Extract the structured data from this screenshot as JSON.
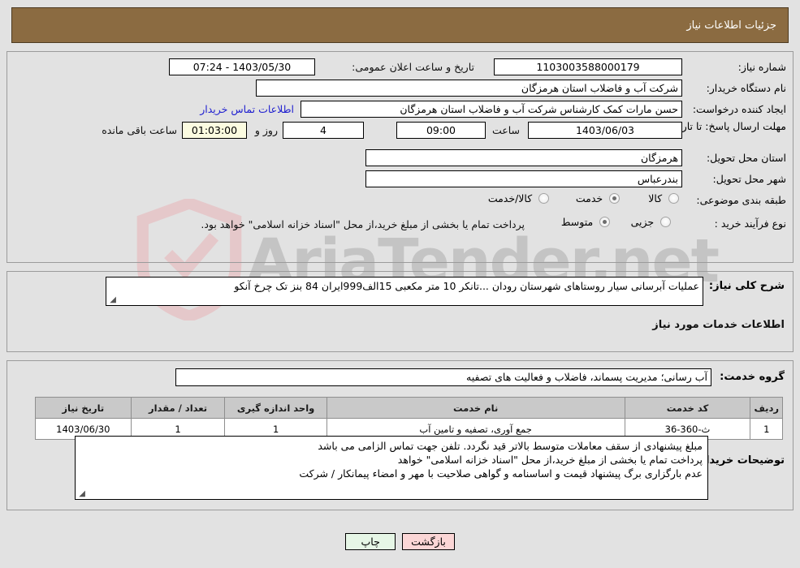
{
  "page": {
    "header_title": "جزئیات اطلاعات نیاز",
    "watermark_text": "AriaTender.net"
  },
  "colors": {
    "header_bg": "#8b6b41",
    "header_text": "#ffffff",
    "page_bg": "#e2e2e2",
    "link": "#2020d0",
    "table_header_bg": "#c9c9c9",
    "highlight_field_bg": "#fbfbe0",
    "print_button_bg": "#e6f6e6",
    "back_button_bg": "#fbd6d6"
  },
  "info": {
    "need_number_label": "شماره نیاز:",
    "need_number_value": "1103003588000179",
    "announce_datetime_label": "تاریخ و ساعت اعلان عمومی:",
    "announce_datetime_value": "1403/05/30 - 07:24",
    "buyer_org_label": "نام دستگاه خریدار:",
    "buyer_org_value": "شرکت آب و فاضلاب استان هرمزگان",
    "creator_label": "ایجاد کننده درخواست:",
    "creator_value": "حسن مارات کمک کارشناس شرکت آب و فاضلاب استان هرمزگان",
    "contact_link": "اطلاعات تماس خریدار",
    "deadline_label": "مهلت ارسال پاسخ: تا تاریخ:",
    "deadline_date": "1403/06/03",
    "hour_label": "ساعت",
    "hour_value": "09:00",
    "days_value": "4",
    "days_and_label": "روز و",
    "remaining_value": "01:03:00",
    "remaining_label": "ساعت باقی مانده",
    "province_label": "استان محل تحویل:",
    "province_value": "هرمزگان",
    "city_label": "شهر محل تحویل:",
    "city_value": "بندرعباس",
    "category_label": "طبقه بندی موضوعی:",
    "category_options": [
      "کالا",
      "خدمت",
      "کالا/خدمت"
    ],
    "category_selected": "خدمت",
    "process_label": "نوع فرآیند خرید :",
    "process_options": [
      "جزیی",
      "متوسط"
    ],
    "process_selected": "متوسط",
    "treasury_note": "پرداخت تمام یا بخشی از مبلغ خرید،از محل \"اسناد خزانه اسلامی\" خواهد بود."
  },
  "description": {
    "label": "شرح کلی نیاز:",
    "value": "عملیات آبرسانی سیار روستاهای شهرستان رودان ...تانکر 10 متر مکعبی 15الف999ایران 84  بنز تک چرخ آنکو"
  },
  "services": {
    "section_title": "اطلاعات خدمات مورد نیاز",
    "group_label": "گروه خدمت:",
    "group_value": "آب رسانی؛ مدیریت پسماند، فاضلاب و فعالیت های تصفیه",
    "columns": [
      "ردیف",
      "کد خدمت",
      "نام خدمت",
      "واحد اندازه گیری",
      "تعداد / مقدار",
      "تاریخ نیاز"
    ],
    "rows": [
      {
        "index": "1",
        "code": "ث-360-36",
        "name": "جمع آوری، تصفیه و تامین آب",
        "unit": "1",
        "quantity": "1",
        "need_date": "1403/06/30"
      }
    ]
  },
  "buyer_notes": {
    "label": "توضیحات خریدار:",
    "line1": "مبلغ پیشنهادی از سقف معاملات متوسط بالاتر قید نگردد. تلفن جهت تماس الزامی می باشد",
    "line2": "پرداخت تمام یا بخشی از مبلغ خرید،از محل \"اسناد خزانه اسلامی\" خواهد",
    "line3": "عدم بارگزاری برگ پیشنهاد قیمت و اساسنامه و گواهی صلاحیت با مهر و امضاء پیمانکار / شرکت"
  },
  "buttons": {
    "print": "چاپ",
    "back": "بازگشت"
  }
}
